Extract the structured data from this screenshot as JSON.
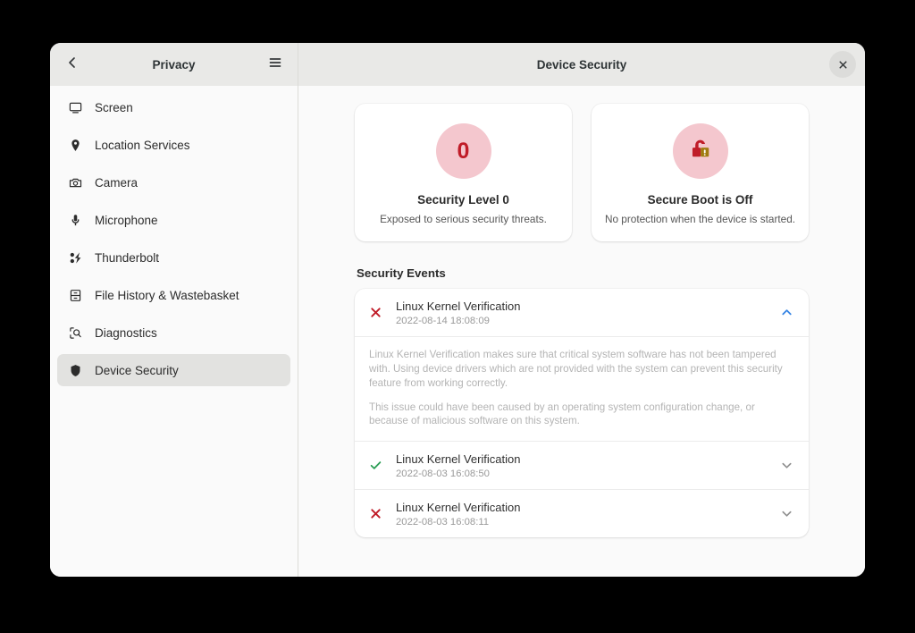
{
  "window": {
    "sidebar_header": {
      "title": "Privacy",
      "back_icon": "back-chevron-icon",
      "menu_icon": "hamburger-menu-icon"
    },
    "content_header": {
      "title": "Device Security",
      "close_icon": "close-icon"
    }
  },
  "sidebar": {
    "items": [
      {
        "label": "Screen",
        "icon": "monitor-icon",
        "selected": false
      },
      {
        "label": "Location Services",
        "icon": "location-pin-icon",
        "selected": false
      },
      {
        "label": "Camera",
        "icon": "camera-icon",
        "selected": false
      },
      {
        "label": "Microphone",
        "icon": "microphone-icon",
        "selected": false
      },
      {
        "label": "Thunderbolt",
        "icon": "thunderbolt-icon",
        "selected": false
      },
      {
        "label": "File History & Wastebasket",
        "icon": "file-cabinet-icon",
        "selected": false
      },
      {
        "label": "Diagnostics",
        "icon": "diagnostics-icon",
        "selected": false
      },
      {
        "label": "Device Security",
        "icon": "shield-icon",
        "selected": true
      }
    ]
  },
  "main": {
    "cards": [
      {
        "badge_value": "0",
        "icon": "security-level-badge",
        "title": "Security Level 0",
        "subtitle": "Exposed to serious security threats."
      },
      {
        "icon": "unlocked-padlock-warning-icon",
        "title": "Secure Boot is Off",
        "subtitle": "No protection when the device is started."
      }
    ],
    "section_title": "Security Events",
    "events": [
      {
        "status": "failed",
        "status_icon": "error-x-icon",
        "title": "Linux Kernel Verification",
        "timestamp": "2022-08-14 18:08:09",
        "expanded": true,
        "chevron_icon": "chevron-up-icon",
        "description_paragraphs": [
          "Linux Kernel Verification makes sure that critical system software has not been tampered with. Using device drivers which are not provided with the system can prevent this security feature from working correctly.",
          "This issue could have been caused by an operating system configuration change, or because of malicious software on this system."
        ]
      },
      {
        "status": "passed",
        "status_icon": "success-check-icon",
        "title": "Linux Kernel Verification",
        "timestamp": "2022-08-03 16:08:50",
        "expanded": false,
        "chevron_icon": "chevron-down-icon"
      },
      {
        "status": "failed",
        "status_icon": "error-x-icon",
        "title": "Linux Kernel Verification",
        "timestamp": "2022-08-03 16:08:11",
        "expanded": false,
        "chevron_icon": "chevron-down-icon"
      }
    ]
  },
  "colors": {
    "accent_blue": "#3584e4",
    "error_red": "#c01c28",
    "success_green": "#2a9d54",
    "badge_pink": "#f4c7ce",
    "warning_gold": "#a07b10",
    "header_bg": "#e9e9e7",
    "content_bg": "#fafafa",
    "selection_bg": "#e2e2e0"
  }
}
